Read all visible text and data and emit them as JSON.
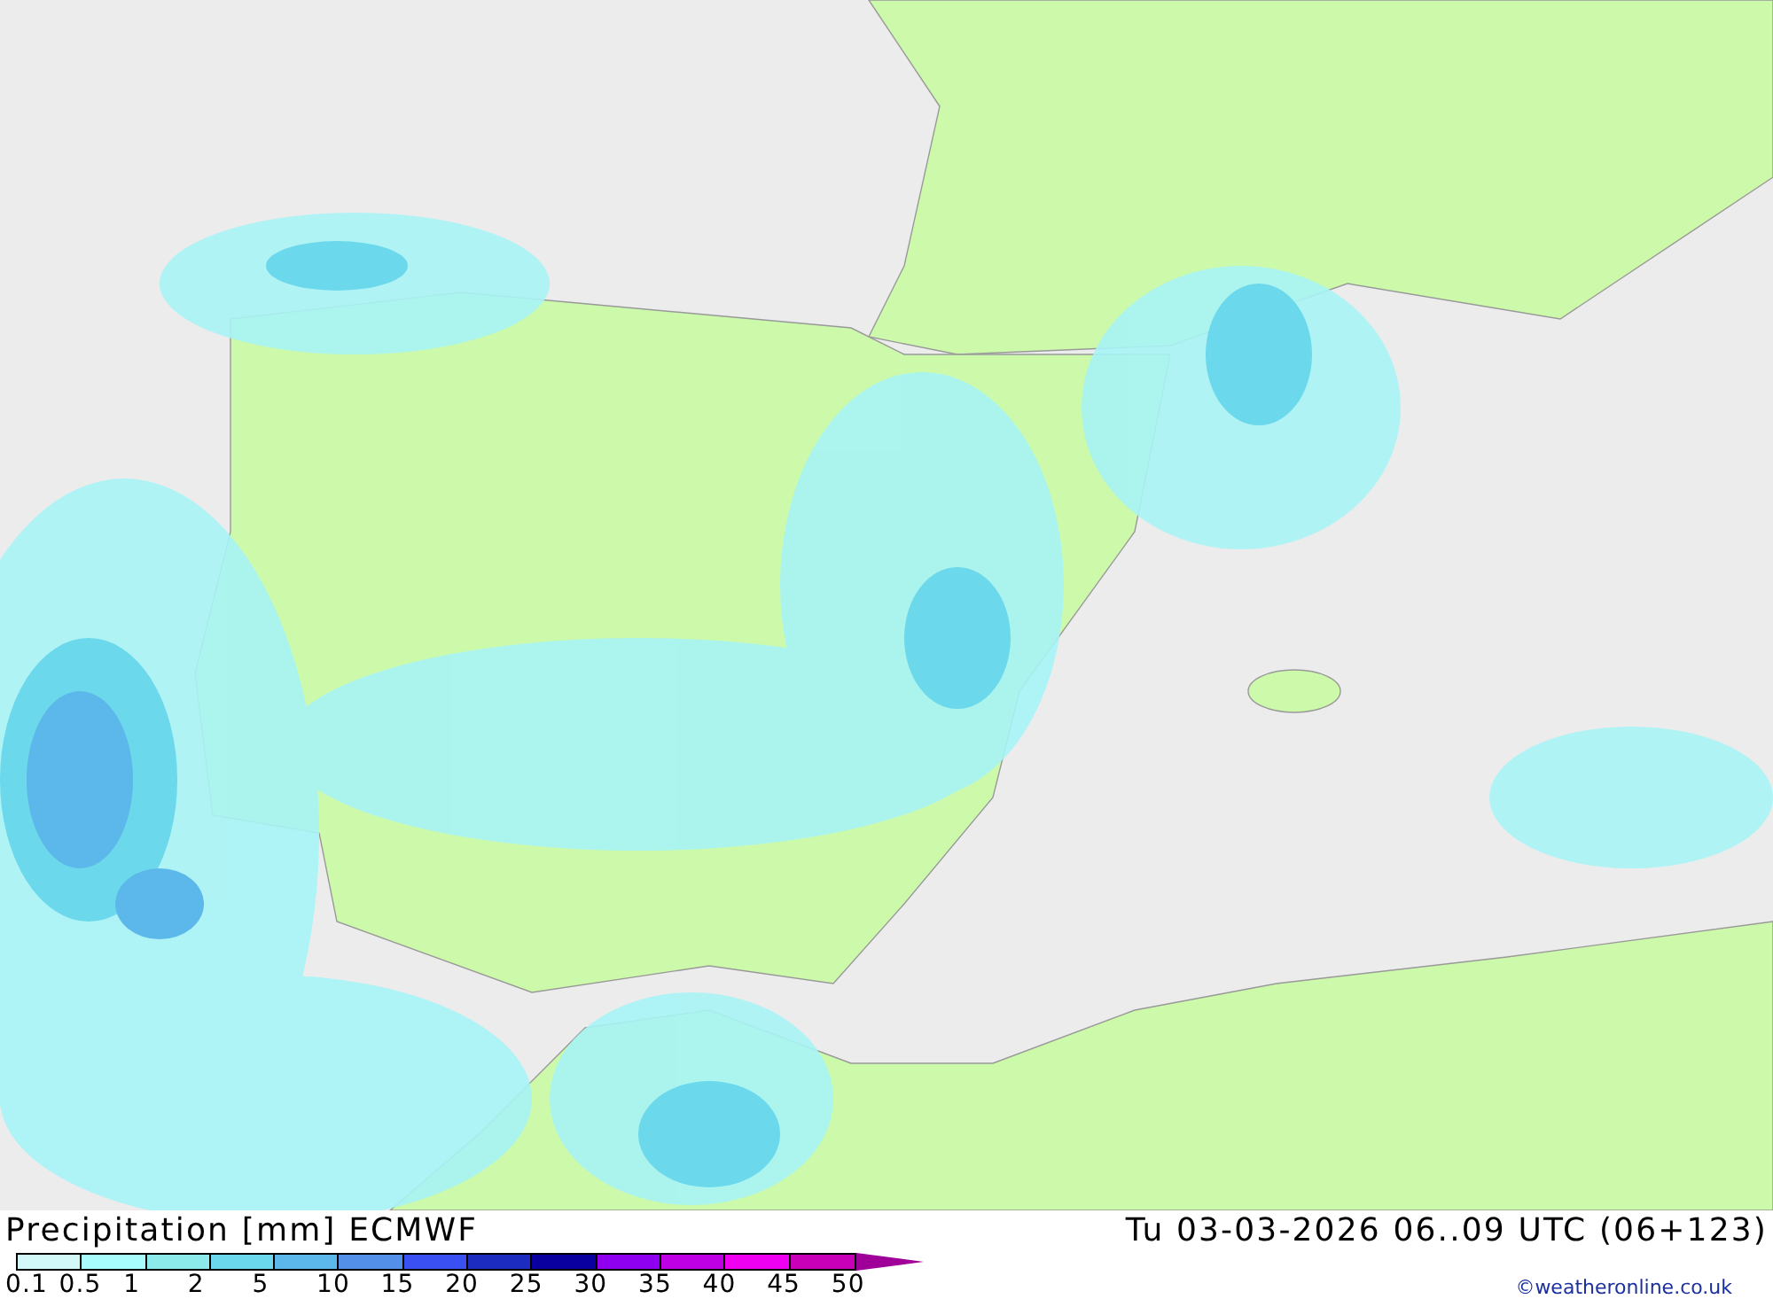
{
  "legend": {
    "title": "Precipitation [mm] ECMWF",
    "bins": [
      {
        "color": "#d2f8f8"
      },
      {
        "color": "#a8fcfc"
      },
      {
        "color": "#8ceaea"
      },
      {
        "color": "#6cd8ec"
      },
      {
        "color": "#5cb8ea"
      },
      {
        "color": "#5290ea"
      },
      {
        "color": "#3a50f2"
      },
      {
        "color": "#1c2cc0"
      },
      {
        "color": "#0a00a0"
      },
      {
        "color": "#9000f0"
      },
      {
        "color": "#c000e4"
      },
      {
        "color": "#f000f0"
      },
      {
        "color": "#c800b8"
      }
    ],
    "labels": [
      "0.1",
      "0.5",
      "1",
      "2",
      "5",
      "10",
      "15",
      "20",
      "25",
      "30",
      "35",
      "40",
      "45",
      "50"
    ]
  },
  "valid_time": "Tu 03-03-2026 06..09 UTC (06+123)",
  "copyright": "©weatheronline.co.uk"
}
